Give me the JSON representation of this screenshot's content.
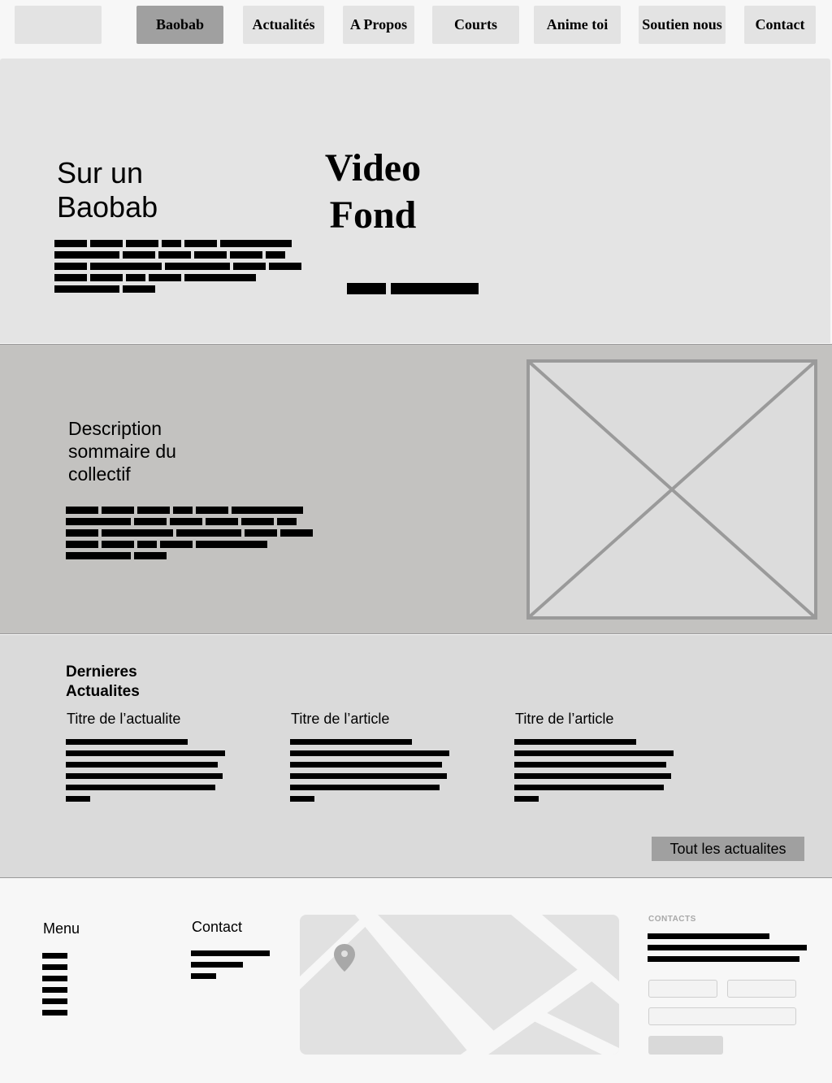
{
  "nav": {
    "items": [
      {
        "label": "Baobab",
        "active": true
      },
      {
        "label": "Actualités",
        "active": false
      },
      {
        "label": "A Propos",
        "active": false
      },
      {
        "label": "Courts",
        "active": false
      },
      {
        "label": "Anime toi",
        "active": false
      },
      {
        "label": "Soutien nous",
        "active": false
      },
      {
        "label": "Contact",
        "active": false
      }
    ]
  },
  "hero": {
    "title": "Sur un Baobab",
    "video_label": "Video Fond"
  },
  "description": {
    "title": "Description sommaire du collectif",
    "image_icon": "image-placeholder-icon"
  },
  "news": {
    "heading": "Dernieres Actualites",
    "articles": [
      {
        "title": "Titre de l’actualite"
      },
      {
        "title": "Titre de l’article"
      },
      {
        "title": "Titre de l’article"
      }
    ],
    "all_button": "Tout les actualites"
  },
  "footer": {
    "menu_heading": "Menu",
    "contact_heading": "Contact",
    "contacts_label": "CONTACTS",
    "map_icon": "map-pin-icon"
  },
  "colors": {
    "nav_active": "#a0a0a0",
    "nav_button": "#e3e3e3",
    "hero_bg": "#e4e4e4",
    "description_bg": "#c3c2c0",
    "news_bg": "#dadada",
    "footer_bg": "#f7f7f7"
  }
}
